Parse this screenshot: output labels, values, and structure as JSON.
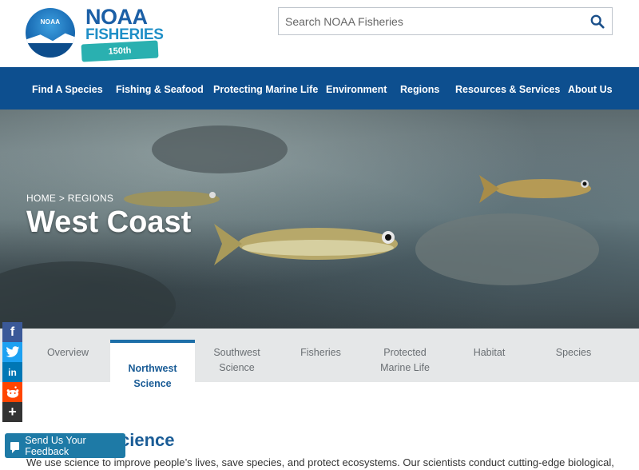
{
  "header": {
    "logo_emblem_text": "NOAA",
    "brand_noaa": "NOAA",
    "brand_fisheries": "FISHERIES",
    "brand_anniversary": "150th ANNIVERSARY",
    "search_placeholder": "Search NOAA Fisheries",
    "search_icon": "search-icon"
  },
  "nav": {
    "items": [
      {
        "label": "Find A Species"
      },
      {
        "label": "Fishing & Seafood"
      },
      {
        "label": "Protecting Marine Life"
      },
      {
        "label": "Environment"
      },
      {
        "label": "Regions"
      },
      {
        "label": "Resources & Services"
      },
      {
        "label": "About Us"
      }
    ]
  },
  "hero": {
    "breadcrumb": "HOME > REGIONS",
    "title": "West Coast"
  },
  "tabs": {
    "items": [
      {
        "label": "Overview",
        "active": false
      },
      {
        "label": "Northwest Science",
        "active": true
      },
      {
        "label": "Southwest Science",
        "active": false
      },
      {
        "label": "Fisheries",
        "active": false
      },
      {
        "label": "Protected Marine Life",
        "active": false
      },
      {
        "label": "Habitat",
        "active": false
      },
      {
        "label": "Species",
        "active": false
      }
    ]
  },
  "content": {
    "section_heading": "cience",
    "intro": "We use science to improve people’s lives, save species, and protect ecosystems. Our scientists conduct cutting-edge biological,"
  },
  "social": {
    "facebook": "f",
    "twitter": "t",
    "linkedin": "in",
    "reddit": "r",
    "more": "+"
  },
  "feedback": {
    "label": "Send Us Your Feedback"
  },
  "colors": {
    "nav_bg": "#0d4f8f",
    "brand_blue": "#1b5fa6",
    "tab_active_border": "#1d6fa8",
    "feedback_bg": "#1e7aa6"
  }
}
